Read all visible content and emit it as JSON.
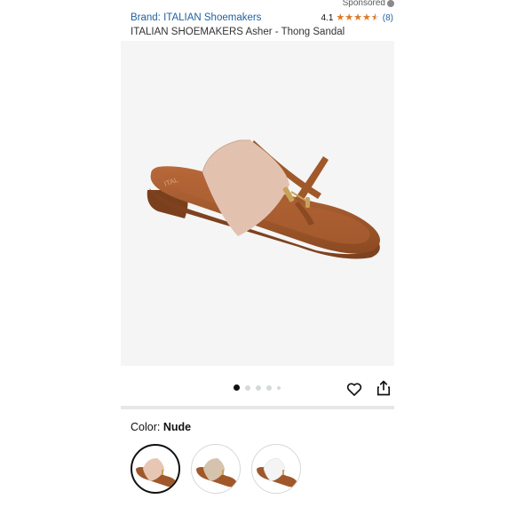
{
  "sponsored_label": "Sponsored",
  "product": {
    "brand_label": "Brand: ITALIAN Shoemakers",
    "title": "ITALIAN SHOEMAKERS Asher - Thong Sandal",
    "rating_value": "4.1",
    "rating": 4.1,
    "review_count": "(8)"
  },
  "gallery": {
    "total_images": 5,
    "active_index": 0
  },
  "actions": {
    "favorite_icon": "heart-outline",
    "share_icon": "share-arrow"
  },
  "color": {
    "label": "Color: ",
    "selected": "Nude",
    "options": [
      "Nude",
      "Taupe",
      "White"
    ]
  },
  "colors": {
    "link": "#2162a1",
    "star": "#de7921",
    "sole_brown": "#a0582a",
    "strap_nude": "#e7c6b4",
    "strap_taupe": "#d6c3ae",
    "strap_white": "#f4f4f4"
  }
}
